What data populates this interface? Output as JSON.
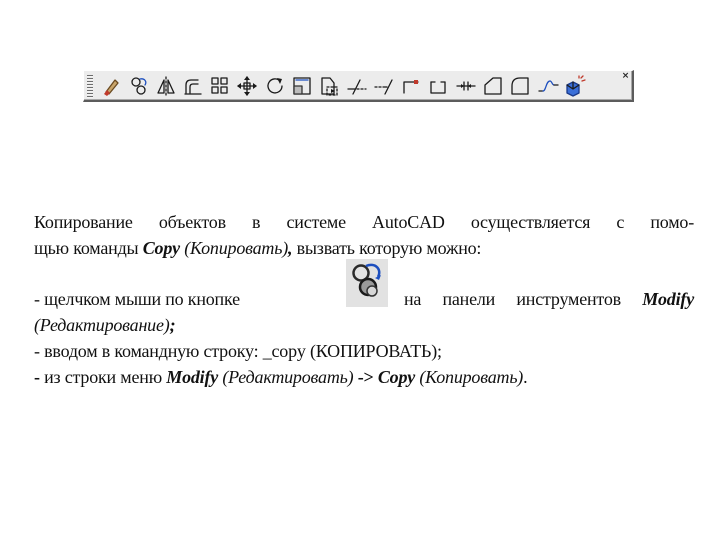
{
  "toolbar": {
    "name": "Modify",
    "close_glyph": "×",
    "buttons": [
      {
        "name": "erase-icon"
      },
      {
        "name": "copy-icon"
      },
      {
        "name": "mirror-icon"
      },
      {
        "name": "offset-icon"
      },
      {
        "name": "array-icon"
      },
      {
        "name": "move-icon"
      },
      {
        "name": "rotate-icon"
      },
      {
        "name": "scale-icon"
      },
      {
        "name": "stretch-icon"
      },
      {
        "name": "trim-icon"
      },
      {
        "name": "extend-icon"
      },
      {
        "name": "break-at-point-icon"
      },
      {
        "name": "break-icon"
      },
      {
        "name": "join-icon"
      },
      {
        "name": "chamfer-icon"
      },
      {
        "name": "fillet-icon"
      },
      {
        "name": "blend-curves-icon"
      },
      {
        "name": "explode-icon"
      }
    ]
  },
  "text": {
    "p1_a": "Копирование объектов в системе AutoCAD осуществляется с помо-",
    "p1_b_pre": "щью команды ",
    "p1_b_copy": "Copy",
    "p1_b_ru": " (Копировать)",
    "p1_b_comma": ",",
    "p1_b_post": " вызвать которую можно:",
    "p2_pre": "- щелчком мыши по кнопке",
    "p2_mid": "на панели инструментов ",
    "p2_modify": "Modify",
    "p3_ru": "(Редактирование)",
    "p3_tail": ";",
    "p4": "- вводом в командную строку: _copy (КОПИРОВАТЬ);",
    "p5_dash": "-",
    "p5_pre": " из строки меню ",
    "p5_modify": "Modify",
    "p5_ru1": " (Редактировать)",
    "p5_arrow": " -> ",
    "p5_copy": "Copy",
    "p5_ru2": " (Копировать)",
    "p5_end": "."
  },
  "colors": {
    "toolbar_bg": "#ececec",
    "icon_accent": "#3b6fd8"
  }
}
